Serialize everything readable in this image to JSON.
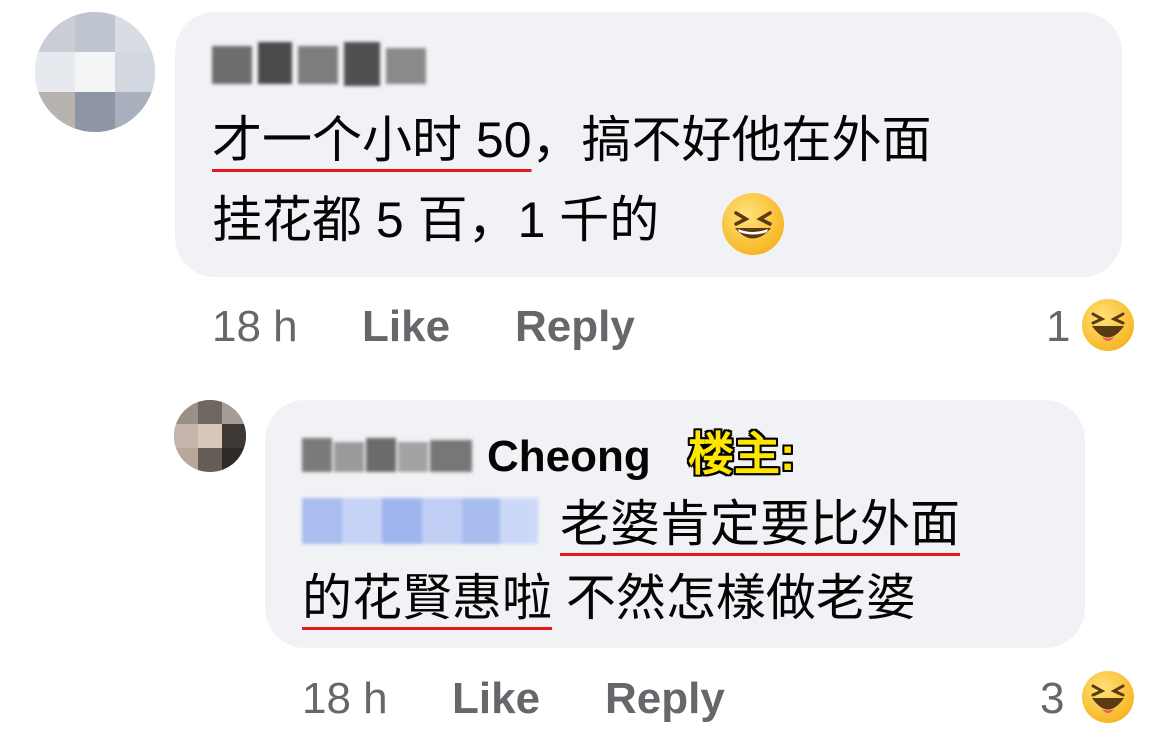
{
  "comment1": {
    "text_line1_underlined": "才一个小时 50",
    "text_line1_rest": "，搞不好他在外面",
    "text_line2": "挂花都 5 百，1 千的",
    "time": "18 h",
    "like_label": "Like",
    "reply_label": "Reply",
    "reaction_count": "1",
    "reaction_icon": "laughing-emoji"
  },
  "reply1": {
    "author_name_visible": "Cheong",
    "op_tag": "楼主:",
    "text_line1_underlined": "老婆肯定要比外面",
    "text_line2_underlined": "的花賢惠啦",
    "text_line2_rest": " 不然怎樣做老婆",
    "time": "18 h",
    "like_label": "Like",
    "reply_label": "Reply",
    "reaction_count": "3",
    "reaction_icon": "laughing-emoji"
  },
  "colors": {
    "bubble": "#f0f2f5",
    "meta_text": "#65676b",
    "underline": "#e01c1c",
    "op_tag": "#ffe600",
    "mention": "#b9c9f5"
  }
}
